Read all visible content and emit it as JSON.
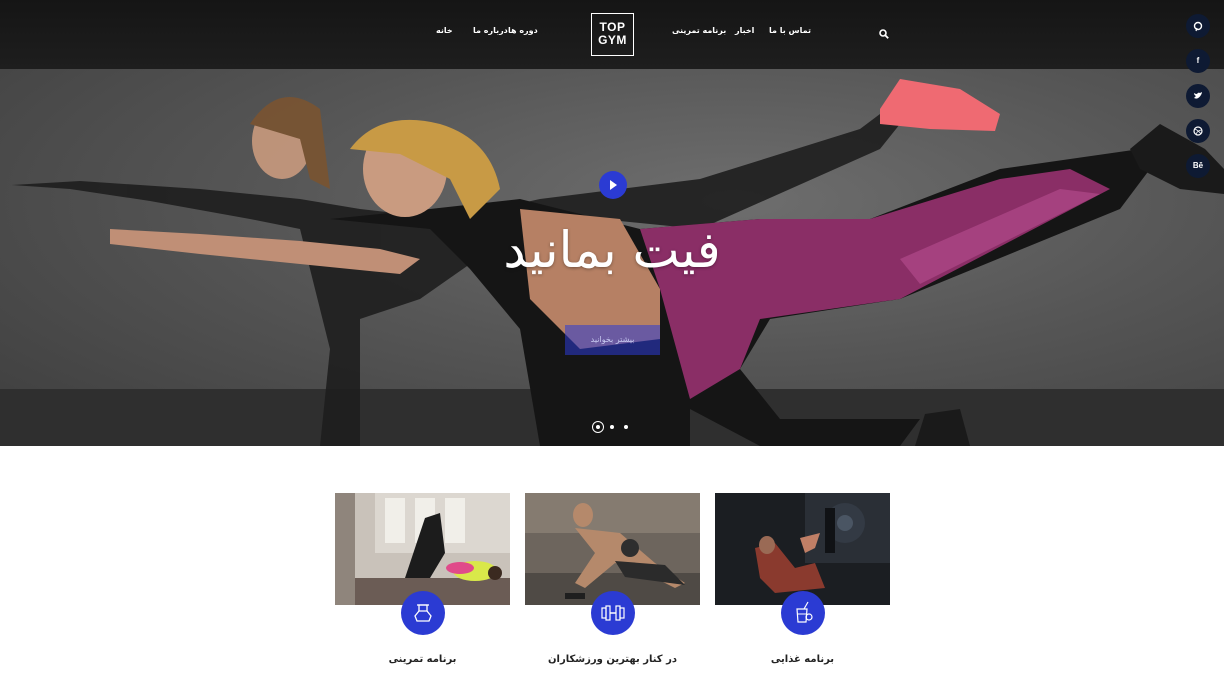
{
  "nav": {
    "left_links": [
      "خانه",
      "درباره ما",
      "دوره ها"
    ],
    "right_links": [
      "برنامه تمرینی",
      "اخبار",
      "تماس با ما"
    ],
    "logo_line1": "TOP",
    "logo_line2": "GYM"
  },
  "hero": {
    "title": "فیت بمانید",
    "button_label": "بیشتر بخوانید",
    "slider_dots": 3,
    "active_dot": 0
  },
  "social": [
    "pinterest",
    "f",
    "twitter",
    "dribbble",
    "Bē"
  ],
  "cards": [
    {
      "title": "برنامه تمرینی",
      "icon": "kettlebell-icon"
    },
    {
      "title": "در کنار بهترین ورزشکاران",
      "icon": "dumbbell-icon"
    },
    {
      "title": "برنامه غذایی",
      "icon": "nutrition-icon"
    }
  ],
  "colors": {
    "accent": "#2b3bd3",
    "header_bg": "#1a1a1a",
    "social_bg": "#0e1a33"
  }
}
